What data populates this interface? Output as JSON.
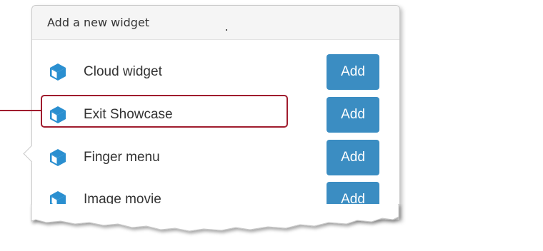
{
  "popup": {
    "title": "Add a new widget"
  },
  "widgets": [
    {
      "label": "Cloud widget",
      "icon": "cube-icon",
      "button": "Add"
    },
    {
      "label": "Exit Showcase",
      "icon": "cube-icon",
      "button": "Add",
      "highlighted": true
    },
    {
      "label": "Finger menu",
      "icon": "cube-icon",
      "button": "Add"
    },
    {
      "label": "Image movie",
      "icon": "cube-icon",
      "button": "Add"
    }
  ],
  "colors": {
    "button": "#3b8dc2",
    "icon": "#2a8fd0",
    "highlight": "#a01c2e",
    "header_bg": "#f5f5f5"
  }
}
